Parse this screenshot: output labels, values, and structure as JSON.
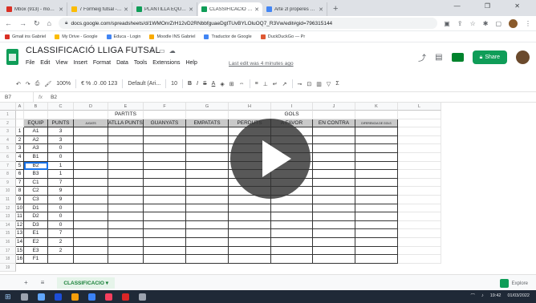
{
  "browser": {
    "tabs": [
      {
        "label": "Mbox (913) - mobil@gi",
        "color": "#d93025"
      },
      {
        "label": "7 Formeig futsal - Google",
        "color": "#fbbc04"
      },
      {
        "label": "PLANTILLA EQUIPS FUTSAL",
        "color": "#0f9d58"
      },
      {
        "label": "CLASSIFICACIO LLIGA FUTSAL",
        "color": "#0f9d58"
      },
      {
        "label": "Arte 2l properes 2NESC",
        "color": "#4285f4"
      }
    ],
    "new_tab": "+",
    "window_controls": "— ❐ ✕",
    "url": "docs.google.com/spreadsheets/d/1WMOnrZrH12vD2RNbbfguaeDgtTUvBYLOluOQ7_R3Vw/edit#gid=796315144"
  },
  "bookmarks": [
    {
      "label": "Gmail ins Gabriel",
      "color": "#d93025"
    },
    {
      "label": "My Drive - Google",
      "color": "#fbbc04"
    },
    {
      "label": "Educa - Login",
      "color": "#4285f4"
    },
    {
      "label": "Moodle INS Gabriel",
      "color": "#f9ab00"
    },
    {
      "label": "Traductor de Google",
      "color": "#4285f4"
    },
    {
      "label": "DuckDuckGo — Pr",
      "color": "#de5833"
    }
  ],
  "sheet": {
    "title": "CLASSIFICACIÓ LLIGA FUTSAL",
    "menus": [
      "File",
      "Edit",
      "View",
      "Insert",
      "Format",
      "Data",
      "Tools",
      "Extensions",
      "Help"
    ],
    "last_edit": "Last edit was 4 minutes ago",
    "share_label": "Share",
    "zoom": "100%",
    "number_format": "€  %  .0  .00  123",
    "font": "Default (Ari...",
    "font_size": "10",
    "namebox": "B7",
    "formula": "B2"
  },
  "columns": [
    "A",
    "B",
    "C",
    "D",
    "E",
    "F",
    "G",
    "H",
    "I",
    "J",
    "K",
    "L"
  ],
  "row_numbers": [
    "1",
    "2",
    "3",
    "4",
    "5",
    "6",
    "7",
    "8",
    "9",
    "10",
    "11",
    "12",
    "13",
    "14",
    "15",
    "16",
    "17",
    "18",
    "19"
  ],
  "table": {
    "group_partits": "PARTITS",
    "group_gols": "GOLS",
    "headers": [
      "EQUIP",
      "PUNTS",
      "JUGATS",
      "ATLLA PUNTS PER PARTIT",
      "GUANYATS",
      "EMPATATS",
      "PERDUTS",
      "A FAVOR",
      "EN CONTRA",
      "DIFERENCIA DE GOLS"
    ],
    "rows": [
      {
        "pos": "1",
        "team": "A1",
        "points": "3"
      },
      {
        "pos": "2",
        "team": "A2",
        "points": "3"
      },
      {
        "pos": "3",
        "team": "A3",
        "points": "0"
      },
      {
        "pos": "4",
        "team": "B1",
        "points": "0"
      },
      {
        "pos": "5",
        "team": "B2",
        "points": "1"
      },
      {
        "pos": "6",
        "team": "B3",
        "points": "1"
      },
      {
        "pos": "7",
        "team": "C1",
        "points": "7"
      },
      {
        "pos": "8",
        "team": "C2",
        "points": "9"
      },
      {
        "pos": "9",
        "team": "C3",
        "points": "9"
      },
      {
        "pos": "10",
        "team": "D1",
        "points": "0"
      },
      {
        "pos": "11",
        "team": "D2",
        "points": "0"
      },
      {
        "pos": "12",
        "team": "D3",
        "points": "0"
      },
      {
        "pos": "13",
        "team": "E1",
        "points": "7"
      },
      {
        "pos": "14",
        "team": "E2",
        "points": "2"
      },
      {
        "pos": "15",
        "team": "E3",
        "points": "2"
      },
      {
        "pos": "16",
        "team": "F1",
        "points": ""
      }
    ]
  },
  "sheet_tab": "CLASSIFICACIO",
  "explore_label": "Explore",
  "taskbar": {
    "time": "19:42",
    "date": "01/03/2022"
  }
}
